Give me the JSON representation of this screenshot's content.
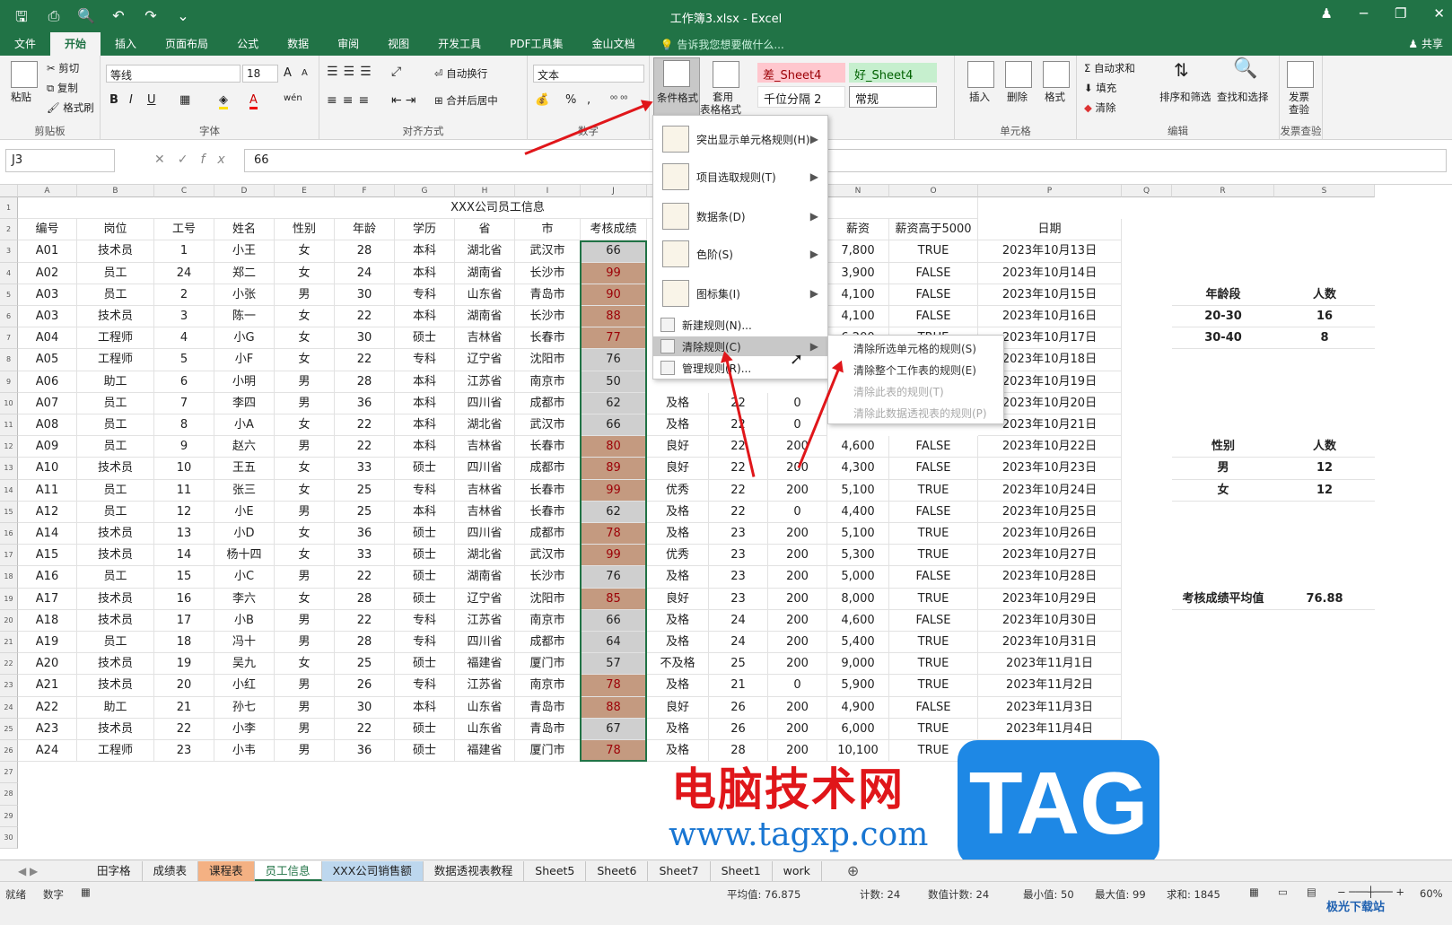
{
  "window": {
    "title": "工作簿3.xlsx - Excel",
    "minimize": "─",
    "restore": "❐",
    "close": "✕",
    "user": "♟"
  },
  "menu": {
    "items": [
      "文件",
      "开始",
      "插入",
      "页面布局",
      "公式",
      "数据",
      "审阅",
      "视图",
      "开发工具",
      "PDF工具集",
      "金山文档"
    ],
    "tell": "告诉我您想要做什么...",
    "share": "共享"
  },
  "ribbon": {
    "clipboard": {
      "paste": "粘贴",
      "cut": "剪切",
      "copy": "复制",
      "painter": "格式刷",
      "label": "剪贴板"
    },
    "font": {
      "name": "等线",
      "size": "18",
      "label": "字体",
      "bold": "B",
      "italic": "I",
      "underline": "U",
      "grow": "A",
      "shrink": "A",
      "wen": "wén"
    },
    "align": {
      "wrap": "自动换行",
      "merge": "合并后居中",
      "label": "对齐方式"
    },
    "number": {
      "format": "文本",
      "label": "数字",
      "pct": "%",
      "comma": ","
    },
    "styles": {
      "cond": "条件格式",
      "table1": "套用",
      "table2": "表格格式",
      "bad": "差_Sheet4",
      "good": "好_Sheet4",
      "thousands": "千位分隔 2",
      "normal": "常规"
    },
    "cells": {
      "insert": "插入",
      "delete": "删除",
      "format": "格式",
      "label": "单元格"
    },
    "edit": {
      "autosum": "自动求和",
      "fill": "填充",
      "clear": "清除",
      "sort": "排序和筛选",
      "find": "查找和选择",
      "label": "编辑"
    },
    "invoice": {
      "check1": "发票",
      "check2": "查验",
      "label": "发票查验"
    }
  },
  "formula": {
    "namebox": "J3",
    "value": "66",
    "fx": "fx",
    "cancel": "✕",
    "enter": "✓"
  },
  "columns": [
    "A",
    "B",
    "C",
    "D",
    "E",
    "F",
    "G",
    "H",
    "I",
    "J",
    "K",
    "L",
    "M",
    "N",
    "O",
    "P",
    "Q",
    "R",
    "S"
  ],
  "rows": [
    "1",
    "2",
    "3",
    "4",
    "5",
    "6",
    "7",
    "8",
    "9",
    "10",
    "11",
    "12",
    "13",
    "14",
    "15",
    "16",
    "17",
    "18",
    "19",
    "20",
    "21",
    "22",
    "23",
    "24",
    "25",
    "26",
    "27",
    "28",
    "29",
    "30"
  ],
  "title": "XXX公司员工信息",
  "headers": {
    "a": "编号",
    "b": "岗位",
    "c": "工号",
    "d": "姓名",
    "e": "性别",
    "f": "年龄",
    "g": "学历",
    "h": "省",
    "i": "市",
    "j": "考核成绩",
    "n": "薪资",
    "o": "薪资高于5000",
    "p": "日期"
  },
  "data": [
    [
      "A01",
      "技术员",
      "1",
      "小王",
      "女",
      "28",
      "本科",
      "湖北省",
      "武汉市",
      "66",
      "",
      "",
      "",
      "7,800",
      "TRUE",
      "2023年10月13日"
    ],
    [
      "A02",
      "员工",
      "24",
      "郑二",
      "女",
      "24",
      "本科",
      "湖南省",
      "长沙市",
      "99",
      "",
      "",
      "",
      "3,900",
      "FALSE",
      "2023年10月14日"
    ],
    [
      "A03",
      "员工",
      "2",
      "小张",
      "男",
      "30",
      "专科",
      "山东省",
      "青岛市",
      "90",
      "",
      "",
      "",
      "4,100",
      "FALSE",
      "2023年10月15日"
    ],
    [
      "A03",
      "技术员",
      "3",
      "陈一",
      "女",
      "22",
      "本科",
      "湖南省",
      "长沙市",
      "88",
      "",
      "",
      "",
      "4,100",
      "FALSE",
      "2023年10月16日"
    ],
    [
      "A04",
      "工程师",
      "4",
      "小G",
      "女",
      "30",
      "硕士",
      "吉林省",
      "长春市",
      "77",
      "",
      "",
      "",
      "6,200",
      "TRUE",
      "2023年10月17日"
    ],
    [
      "A05",
      "工程师",
      "5",
      "小F",
      "女",
      "22",
      "专科",
      "辽宁省",
      "沈阳市",
      "76",
      "",
      "",
      "",
      "",
      "",
      "2023年10月18日"
    ],
    [
      "A06",
      "助工",
      "6",
      "小明",
      "男",
      "28",
      "本科",
      "江苏省",
      "南京市",
      "50",
      "",
      "",
      "",
      "",
      "",
      "2023年10月19日"
    ],
    [
      "A07",
      "员工",
      "7",
      "李四",
      "男",
      "36",
      "本科",
      "四川省",
      "成都市",
      "62",
      "及格",
      "22",
      "0",
      "",
      "",
      "2023年10月20日"
    ],
    [
      "A08",
      "员工",
      "8",
      "小A",
      "女",
      "22",
      "本科",
      "湖北省",
      "武汉市",
      "66",
      "及格",
      "22",
      "0",
      "",
      "",
      "2023年10月21日"
    ],
    [
      "A09",
      "员工",
      "9",
      "赵六",
      "男",
      "22",
      "本科",
      "吉林省",
      "长春市",
      "80",
      "良好",
      "22",
      "200",
      "4,600",
      "FALSE",
      "2023年10月22日"
    ],
    [
      "A10",
      "技术员",
      "10",
      "王五",
      "女",
      "33",
      "硕士",
      "四川省",
      "成都市",
      "89",
      "良好",
      "22",
      "200",
      "4,300",
      "FALSE",
      "2023年10月23日"
    ],
    [
      "A11",
      "员工",
      "11",
      "张三",
      "女",
      "25",
      "专科",
      "吉林省",
      "长春市",
      "99",
      "优秀",
      "22",
      "200",
      "5,100",
      "TRUE",
      "2023年10月24日"
    ],
    [
      "A12",
      "员工",
      "12",
      "小E",
      "男",
      "25",
      "本科",
      "吉林省",
      "长春市",
      "62",
      "及格",
      "22",
      "0",
      "4,400",
      "FALSE",
      "2023年10月25日"
    ],
    [
      "A14",
      "技术员",
      "13",
      "小D",
      "女",
      "36",
      "硕士",
      "四川省",
      "成都市",
      "78",
      "及格",
      "23",
      "200",
      "5,100",
      "TRUE",
      "2023年10月26日"
    ],
    [
      "A15",
      "技术员",
      "14",
      "杨十四",
      "女",
      "33",
      "硕士",
      "湖北省",
      "武汉市",
      "99",
      "优秀",
      "23",
      "200",
      "5,300",
      "TRUE",
      "2023年10月27日"
    ],
    [
      "A16",
      "员工",
      "15",
      "小C",
      "男",
      "22",
      "硕士",
      "湖南省",
      "长沙市",
      "76",
      "及格",
      "23",
      "200",
      "5,000",
      "FALSE",
      "2023年10月28日"
    ],
    [
      "A17",
      "技术员",
      "16",
      "李六",
      "女",
      "28",
      "硕士",
      "辽宁省",
      "沈阳市",
      "85",
      "良好",
      "23",
      "200",
      "8,000",
      "TRUE",
      "2023年10月29日"
    ],
    [
      "A18",
      "技术员",
      "17",
      "小B",
      "男",
      "22",
      "专科",
      "江苏省",
      "南京市",
      "66",
      "及格",
      "24",
      "200",
      "4,600",
      "FALSE",
      "2023年10月30日"
    ],
    [
      "A19",
      "员工",
      "18",
      "冯十",
      "男",
      "28",
      "专科",
      "四川省",
      "成都市",
      "64",
      "及格",
      "24",
      "200",
      "5,400",
      "TRUE",
      "2023年10月31日"
    ],
    [
      "A20",
      "技术员",
      "19",
      "吴九",
      "女",
      "25",
      "硕士",
      "福建省",
      "厦门市",
      "57",
      "不及格",
      "25",
      "200",
      "9,000",
      "TRUE",
      "2023年11月1日"
    ],
    [
      "A21",
      "技术员",
      "20",
      "小红",
      "男",
      "26",
      "专科",
      "江苏省",
      "南京市",
      "78",
      "及格",
      "21",
      "0",
      "5,900",
      "TRUE",
      "2023年11月2日"
    ],
    [
      "A22",
      "助工",
      "21",
      "孙七",
      "男",
      "30",
      "本科",
      "山东省",
      "青岛市",
      "88",
      "良好",
      "26",
      "200",
      "4,900",
      "FALSE",
      "2023年11月3日"
    ],
    [
      "A23",
      "技术员",
      "22",
      "小李",
      "男",
      "22",
      "硕士",
      "山东省",
      "青岛市",
      "67",
      "及格",
      "26",
      "200",
      "6,000",
      "TRUE",
      "2023年11月4日"
    ],
    [
      "A24",
      "工程师",
      "23",
      "小韦",
      "男",
      "36",
      "硕士",
      "福建省",
      "厦门市",
      "78",
      "及格",
      "28",
      "200",
      "10,100",
      "TRUE",
      "2023年11月5日"
    ]
  ],
  "highlight_rows": [
    1,
    2,
    3,
    4,
    9,
    10,
    11,
    13,
    14,
    16,
    20,
    21,
    23
  ],
  "summary": {
    "age_title": "年龄段",
    "count_title": "人数",
    "age_rows": [
      [
        "20-30",
        "16"
      ],
      [
        "30-40",
        "8"
      ]
    ],
    "sex_title": "性别",
    "sex_count_title": "人数",
    "sex_rows": [
      [
        "男",
        "12"
      ],
      [
        "女",
        "12"
      ]
    ],
    "avg_label": "考核成绩平均值",
    "avg_value": "76.88"
  },
  "extra_dates": [
    "2023年10月19日",
    "2023年10月18日"
  ],
  "dropdown": {
    "items": [
      "突出显示单元格规则(H)",
      "项目选取规则(T)",
      "数据条(D)",
      "色阶(S)",
      "图标集(I)",
      "新建规则(N)...",
      "清除规则(C)",
      "管理规则(R)..."
    ]
  },
  "submenu": {
    "items": [
      "清除所选单元格的规则(S)",
      "清除整个工作表的规则(E)",
      "清除此表的规则(T)",
      "清除此数据透视表的规则(P)"
    ]
  },
  "tabs": [
    "田字格",
    "成绩表",
    "课程表",
    "员工信息",
    "XXX公司销售额",
    "数据透视表教程",
    "Sheet5",
    "Sheet6",
    "Sheet7",
    "Sheet1",
    "work"
  ],
  "status": {
    "ready": "就绪",
    "num": "数字",
    "avg": "平均值: 76.875",
    "count": "计数: 24",
    "numcount": "数值计数: 24",
    "min": "最小值: 50",
    "max": "最大值: 99",
    "sum": "求和: 1845",
    "zoom": "60%"
  },
  "watermark": {
    "cn": "电脑技术网",
    "url": "www.tagxp.com",
    "tag": "TAG",
    "site": "极光下载站"
  },
  "colors": {
    "excel_green": "#217346",
    "cond_red_fill": "#c49a80",
    "cond_red_text": "#9c0006",
    "cond_grey": "#cfcfcf",
    "arrow": "#e0161a"
  }
}
